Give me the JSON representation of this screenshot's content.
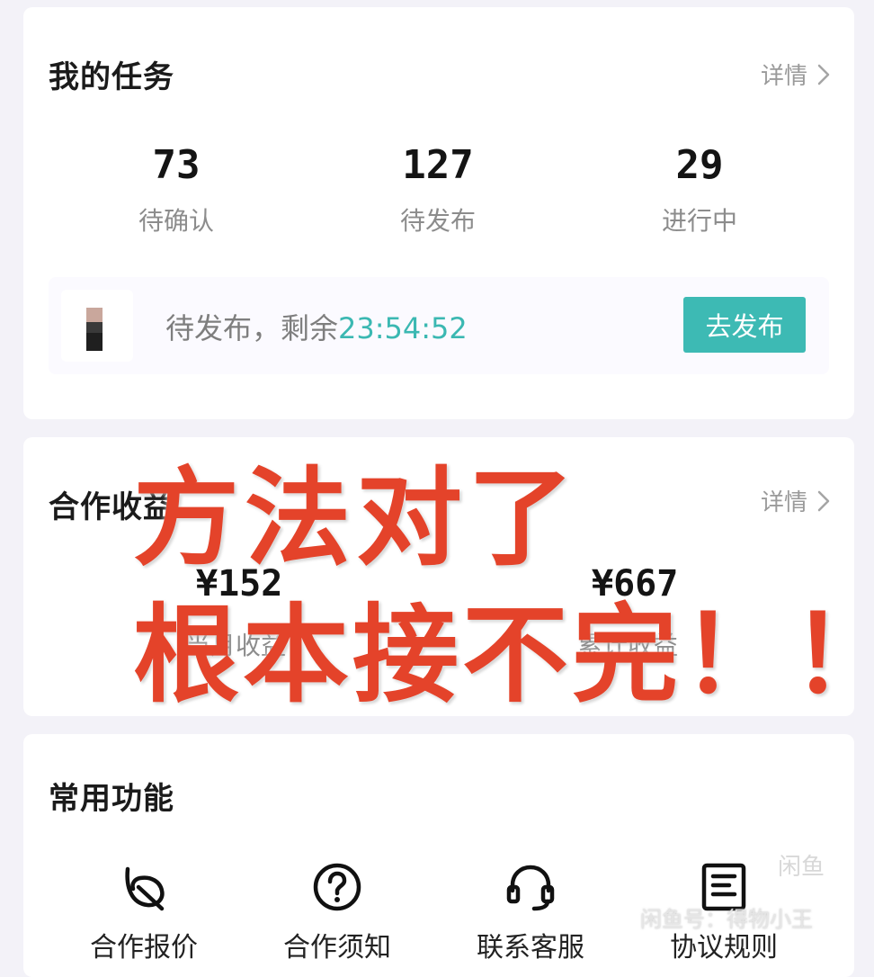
{
  "tasks": {
    "title": "我的任务",
    "detail_label": "详情",
    "stats": [
      {
        "value": "73",
        "label": "待确认"
      },
      {
        "value": "127",
        "label": "待发布"
      },
      {
        "value": "29",
        "label": "进行中"
      }
    ],
    "publish": {
      "prefix": "待发布，剩余",
      "countdown": "23:54:52",
      "button_label": "去发布"
    }
  },
  "income": {
    "title": "合作收益",
    "detail_label": "详情",
    "month_value": "¥152",
    "month_label": "当月收益",
    "total_value": "¥667",
    "total_label": "累计收益"
  },
  "functions": {
    "title": "常用功能",
    "items": [
      {
        "label": "合作报价",
        "icon": "leaf-icon"
      },
      {
        "label": "合作须知",
        "icon": "question-circle-icon"
      },
      {
        "label": "联系客服",
        "icon": "headset-icon"
      },
      {
        "label": "协议规则",
        "icon": "document-icon"
      }
    ]
  },
  "overlay": {
    "line1": "方法对了",
    "line2": "根本接不完！！",
    "color": "#e4432a"
  },
  "watermark": {
    "badge": "闲鱼",
    "text": "闲鱼号：得物小王"
  },
  "colors": {
    "accent": "#3dbab4",
    "countdown": "#3bb8b2"
  }
}
